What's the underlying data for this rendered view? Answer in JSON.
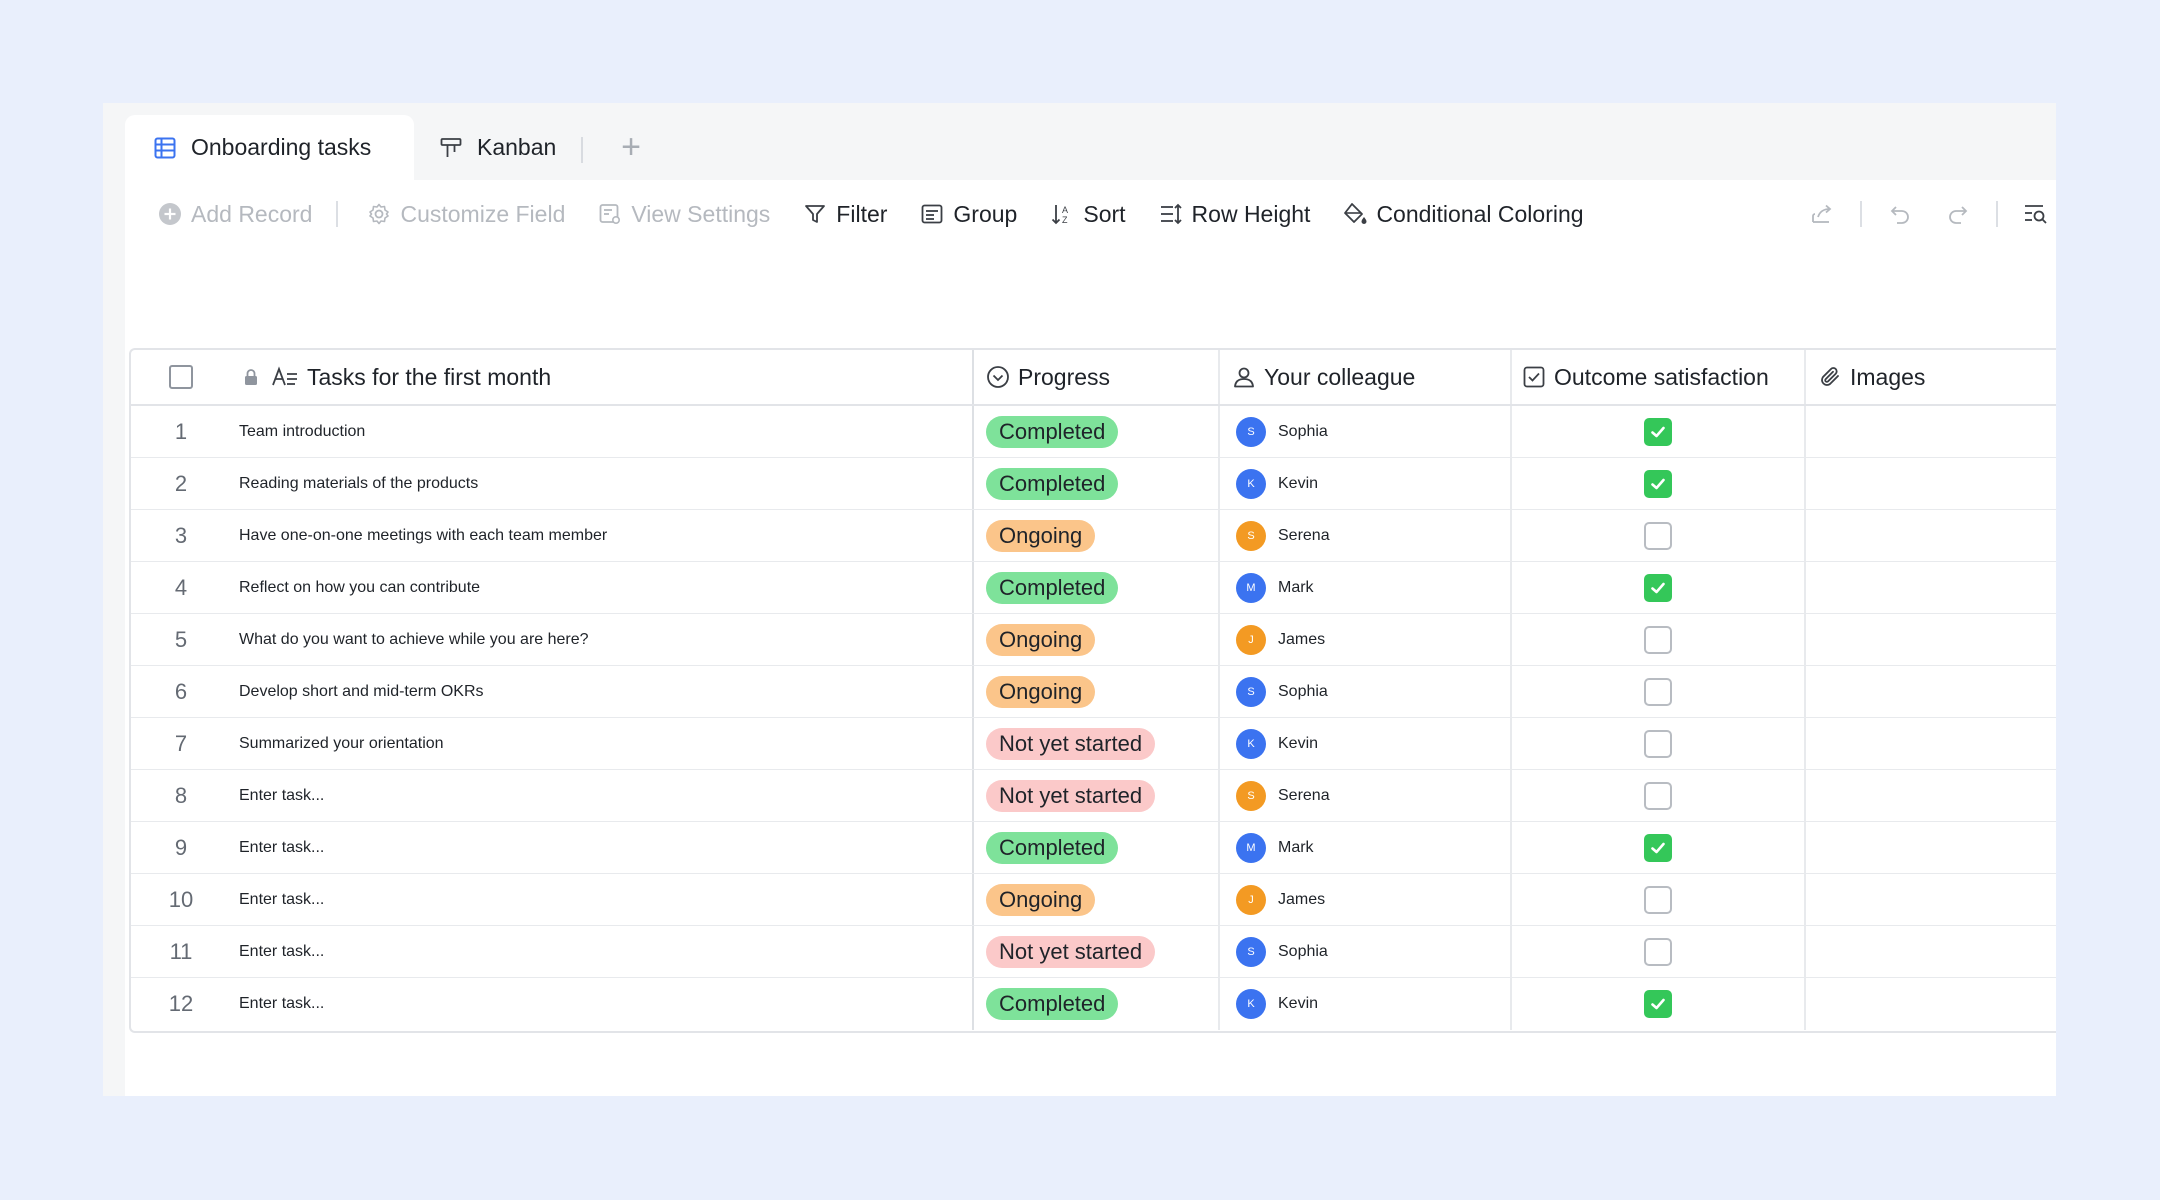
{
  "tabs": [
    {
      "label": "Onboarding tasks",
      "icon": "table-icon",
      "active": true
    },
    {
      "label": "Kanban",
      "icon": "kanban-icon",
      "active": false
    }
  ],
  "toolbar": {
    "add_record": "Add Record",
    "customize_field": "Customize Field",
    "view_settings": "View Settings",
    "filter": "Filter",
    "group": "Group",
    "sort": "Sort",
    "row_height": "Row Height",
    "conditional_coloring": "Conditional Coloring"
  },
  "columns": {
    "task": "Tasks for the first month",
    "progress": "Progress",
    "colleague": "Your colleague",
    "outcome": "Outcome satisfaction",
    "images": "Images"
  },
  "status_colors": {
    "Completed": "#7ee29a",
    "Ongoing": "#fbc58a",
    "Not yet started": "#fbc9c9"
  },
  "avatar_colors": {
    "blue": "#3b73f0",
    "orange": "#f39a23"
  },
  "rows": [
    {
      "index": "1",
      "task": "Team introduction",
      "progress": "Completed",
      "colleague": "Sophia",
      "initial": "S",
      "avatar": "blue",
      "checked": true
    },
    {
      "index": "2",
      "task": "Reading materials of the products",
      "progress": "Completed",
      "colleague": "Kevin",
      "initial": "K",
      "avatar": "blue",
      "checked": true
    },
    {
      "index": "3",
      "task": "Have one-on-one meetings with each team member",
      "progress": "Ongoing",
      "colleague": "Serena",
      "initial": "S",
      "avatar": "orange",
      "checked": false
    },
    {
      "index": "4",
      "task": "Reflect on how you can contribute",
      "progress": "Completed",
      "colleague": "Mark",
      "initial": "M",
      "avatar": "blue",
      "checked": true
    },
    {
      "index": "5",
      "task": "What do you want to achieve while you are here?",
      "progress": "Ongoing",
      "colleague": "James",
      "initial": "J",
      "avatar": "orange",
      "checked": false
    },
    {
      "index": "6",
      "task": "Develop short and mid-term OKRs",
      "progress": "Ongoing",
      "colleague": "Sophia",
      "initial": "S",
      "avatar": "blue",
      "checked": false
    },
    {
      "index": "7",
      "task": "Summarized your orientation",
      "progress": "Not yet started",
      "colleague": "Kevin",
      "initial": "K",
      "avatar": "blue",
      "checked": false
    },
    {
      "index": "8",
      "task": "Enter task...",
      "progress": "Not yet started",
      "colleague": "Serena",
      "initial": "S",
      "avatar": "orange",
      "checked": false
    },
    {
      "index": "9",
      "task": "Enter task...",
      "progress": "Completed",
      "colleague": "Mark",
      "initial": "M",
      "avatar": "blue",
      "checked": true
    },
    {
      "index": "10",
      "task": "Enter task...",
      "progress": "Ongoing",
      "colleague": "James",
      "initial": "J",
      "avatar": "orange",
      "checked": false
    },
    {
      "index": "11",
      "task": "Enter task...",
      "progress": "Not yet started",
      "colleague": "Sophia",
      "initial": "S",
      "avatar": "blue",
      "checked": false
    },
    {
      "index": "12",
      "task": "Enter task...",
      "progress": "Completed",
      "colleague": "Kevin",
      "initial": "K",
      "avatar": "blue",
      "checked": true
    }
  ]
}
